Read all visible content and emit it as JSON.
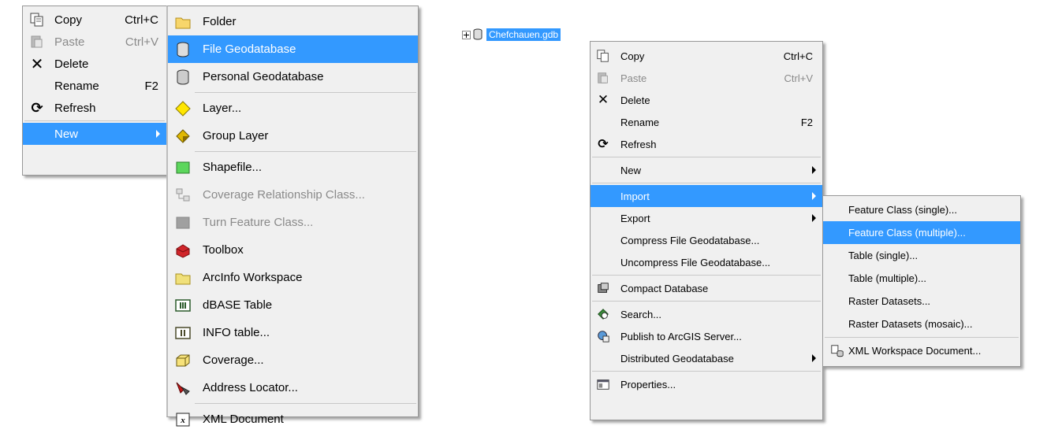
{
  "menu_a": {
    "copy": {
      "label": "Copy",
      "shortcut": "Ctrl+C"
    },
    "paste": {
      "label": "Paste",
      "shortcut": "Ctrl+V"
    },
    "delete": {
      "label": "Delete"
    },
    "rename": {
      "label": "Rename",
      "shortcut": "F2"
    },
    "refresh": {
      "label": "Refresh"
    },
    "new": {
      "label": "New"
    }
  },
  "menu_new": {
    "folder": "Folder",
    "file_geodatabase": "File Geodatabase",
    "personal_geodatabase": "Personal Geodatabase",
    "layer": "Layer...",
    "group_layer": "Group Layer",
    "shapefile": "Shapefile...",
    "coverage_relationship_class": "Coverage Relationship Class...",
    "turn_feature_class": "Turn Feature Class...",
    "toolbox": "Toolbox",
    "arcinfo_workspace": "ArcInfo Workspace",
    "dbase_table": "dBASE Table",
    "info_table": "INFO table...",
    "coverage": "Coverage...",
    "address_locator": "Address Locator...",
    "xml_document": "XML Document"
  },
  "tree": {
    "node_label": "Chefchauen.gdb"
  },
  "menu_gdb": {
    "copy": {
      "label": "Copy",
      "shortcut": "Ctrl+C"
    },
    "paste": {
      "label": "Paste",
      "shortcut": "Ctrl+V"
    },
    "delete": {
      "label": "Delete"
    },
    "rename": {
      "label": "Rename",
      "shortcut": "F2"
    },
    "refresh": {
      "label": "Refresh"
    },
    "new": {
      "label": "New"
    },
    "import": {
      "label": "Import"
    },
    "export": {
      "label": "Export"
    },
    "compress": {
      "label": "Compress File Geodatabase..."
    },
    "uncompress": {
      "label": "Uncompress File Geodatabase..."
    },
    "compact": {
      "label": "Compact Database"
    },
    "search": {
      "label": "Search..."
    },
    "publish": {
      "label": "Publish to ArcGIS Server..."
    },
    "distributed": {
      "label": "Distributed Geodatabase"
    },
    "properties": {
      "label": "Properties..."
    }
  },
  "menu_import": {
    "fc_single": "Feature Class (single)...",
    "fc_multiple": "Feature Class (multiple)...",
    "table_single": "Table (single)...",
    "table_multiple": "Table (multiple)...",
    "raster_datasets": "Raster Datasets...",
    "raster_mosaic": "Raster Datasets (mosaic)...",
    "xml_workspace": "XML Workspace Document..."
  },
  "colors": {
    "highlight": "#3399ff",
    "menu_bg": "#f0f0f0",
    "disabled_text": "#8a8a8a"
  }
}
